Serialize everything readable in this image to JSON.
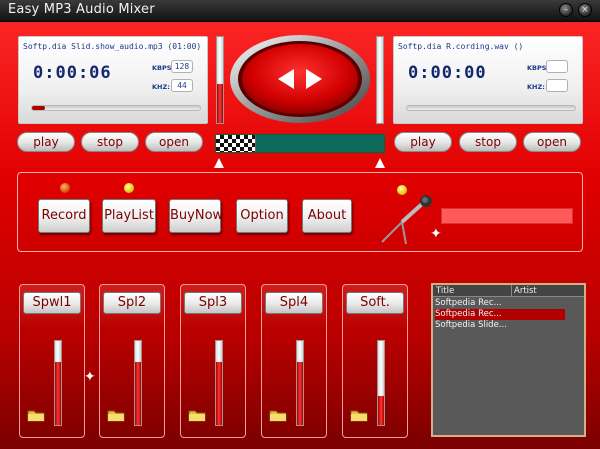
{
  "window": {
    "title": "Easy MP3 Audio Mixer",
    "controls": {
      "minimize": "–",
      "close": "×"
    }
  },
  "left_deck": {
    "file": "Softp.dia Slid.show_audio.mp3 (01:00)",
    "time": "0:00:06",
    "kbps_label": "KBPS:",
    "kbps_value": "128",
    "khz_label": "KHZ:",
    "khz_value": "44",
    "seek_progress": 0.08,
    "volume_level": 0.45,
    "play_label": "play",
    "stop_label": "stop",
    "open_label": "open"
  },
  "right_deck": {
    "file": "Softp.dia R.cording.wav ()",
    "time": "0:00:00",
    "kbps_label": "KBPS:",
    "kbps_value": "",
    "khz_label": "KHZ:",
    "khz_value": "",
    "seek_progress": 0.0,
    "volume_level": 0.0,
    "play_label": "play",
    "stop_label": "stop",
    "open_label": "open"
  },
  "crossfader": {
    "position": 0.0
  },
  "panel": {
    "record": "Record",
    "playlist": "PlayList",
    "buynow": "BuyNow",
    "option": "Option",
    "about": "About"
  },
  "channels": [
    {
      "label": "Spwl1",
      "level": 0.75
    },
    {
      "label": "Spl2",
      "level": 0.75
    },
    {
      "label": "Spl3",
      "level": 0.75
    },
    {
      "label": "Spl4",
      "level": 0.75
    },
    {
      "label": "Soft.",
      "level": 0.35
    }
  ],
  "playlist_panel": {
    "columns": [
      "Title",
      "Artist"
    ],
    "rows": [
      {
        "title": "Softpedia Rec...",
        "selected": false
      },
      {
        "title": "Softpedia Rec...",
        "selected": true
      },
      {
        "title": "Softpedia Slide...",
        "selected": false
      }
    ]
  },
  "icons": {
    "disc": "prev-next-disc-icon",
    "folder": "folder-icon",
    "microphone": "microphone-icon"
  },
  "colors": {
    "background": "#e00000",
    "accent_text": "#7a0000",
    "display_text": "#14286e",
    "crossfader_track": "#0e6a5a",
    "playlist_bg": "#595959",
    "playlist_selected": "#b00000"
  }
}
